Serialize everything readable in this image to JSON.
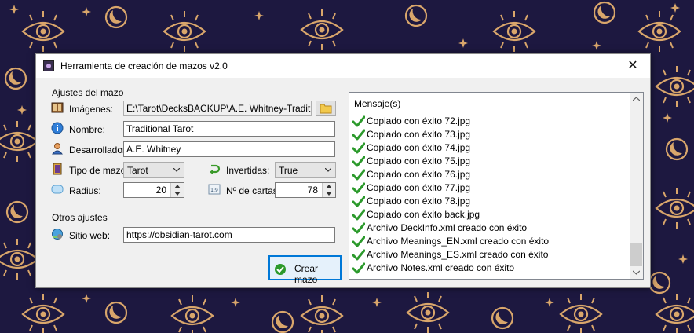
{
  "window": {
    "title": "Herramienta de creación de mazos v2.0",
    "close_glyph": "✕"
  },
  "deck_settings": {
    "group_title": "Ajustes del mazo",
    "images_label": "Imágenes:",
    "images_path": "E:\\Tarot\\DecksBACKUP\\A.E. Whitney-Traditional Tarot",
    "name_label": "Nombre:",
    "name_value": "Traditional Tarot",
    "developer_label": "Desarrollador:",
    "developer_value": "A.E. Whitney",
    "deck_type_label": "Tipo de mazo:",
    "deck_type_value": "Tarot",
    "inverted_label": "Invertidas:",
    "inverted_value": "True",
    "radius_label": "Radius:",
    "radius_value": "20",
    "card_count_label": "Nº de cartas:",
    "card_count_value": "78"
  },
  "other_settings": {
    "group_title": "Otros ajustes",
    "website_label": "Sitio web:",
    "website_value": "https://obsidian-tarot.com"
  },
  "create_button_label": "Crear mazo",
  "messages": {
    "header": "Mensaje(s)",
    "items": [
      "Copiado con éxito 72.jpg",
      "Copiado con éxito 73.jpg",
      "Copiado con éxito 74.jpg",
      "Copiado con éxito 75.jpg",
      "Copiado con éxito 76.jpg",
      "Copiado con éxito 77.jpg",
      "Copiado con éxito 78.jpg",
      "Copiado con éxito back.jpg",
      "Archivo DeckInfo.xml creado con éxito",
      "Archivo Meanings_EN.xml creado con éxito",
      "Archivo Meanings_ES.xml creado con éxito",
      "Archivo Notes.xml creado con éxito"
    ]
  },
  "colors": {
    "wallpaper_bg": "#1d1840",
    "wallpaper_pattern": "#d9a66b",
    "accent": "#0078d7",
    "check_green": "#2c9a2c"
  }
}
